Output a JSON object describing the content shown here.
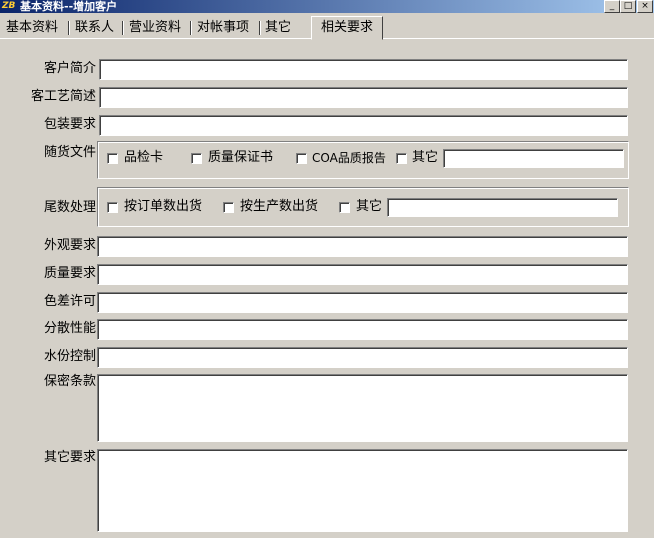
{
  "window": {
    "title": "基本资料--增加客户",
    "icon_text": "ZB",
    "controls": [
      "_",
      "□",
      "×"
    ]
  },
  "tabs": [
    "基本资料",
    "联系人",
    "营业资料",
    "对帐事项",
    "其它",
    "相关要求"
  ],
  "active_tab": "相关要求",
  "form": {
    "customer_intro": {
      "label": "客户简介",
      "value": ""
    },
    "process_desc": {
      "label": "客工艺简述",
      "value": ""
    },
    "packaging": {
      "label": "包装要求",
      "value": ""
    },
    "documents": {
      "label": "随货文件",
      "options": [
        "品检卡",
        "质量保证书",
        "COA品质报告",
        "其它"
      ],
      "other_value": ""
    },
    "remainder": {
      "label": "尾数处理",
      "options": [
        "按订单数出货",
        "按生产数出货",
        "其它"
      ],
      "other_value": ""
    },
    "appearance": {
      "label": "外观要求",
      "value": ""
    },
    "quality": {
      "label": "质量要求",
      "value": ""
    },
    "color_diff": {
      "label": "色差许可",
      "value": ""
    },
    "dispersion": {
      "label": "分散性能",
      "value": ""
    },
    "moisture": {
      "label": "水份控制",
      "value": ""
    },
    "confidentiality": {
      "label": "保密条款",
      "value": ""
    },
    "other_req": {
      "label": "其它要求",
      "value": ""
    }
  }
}
